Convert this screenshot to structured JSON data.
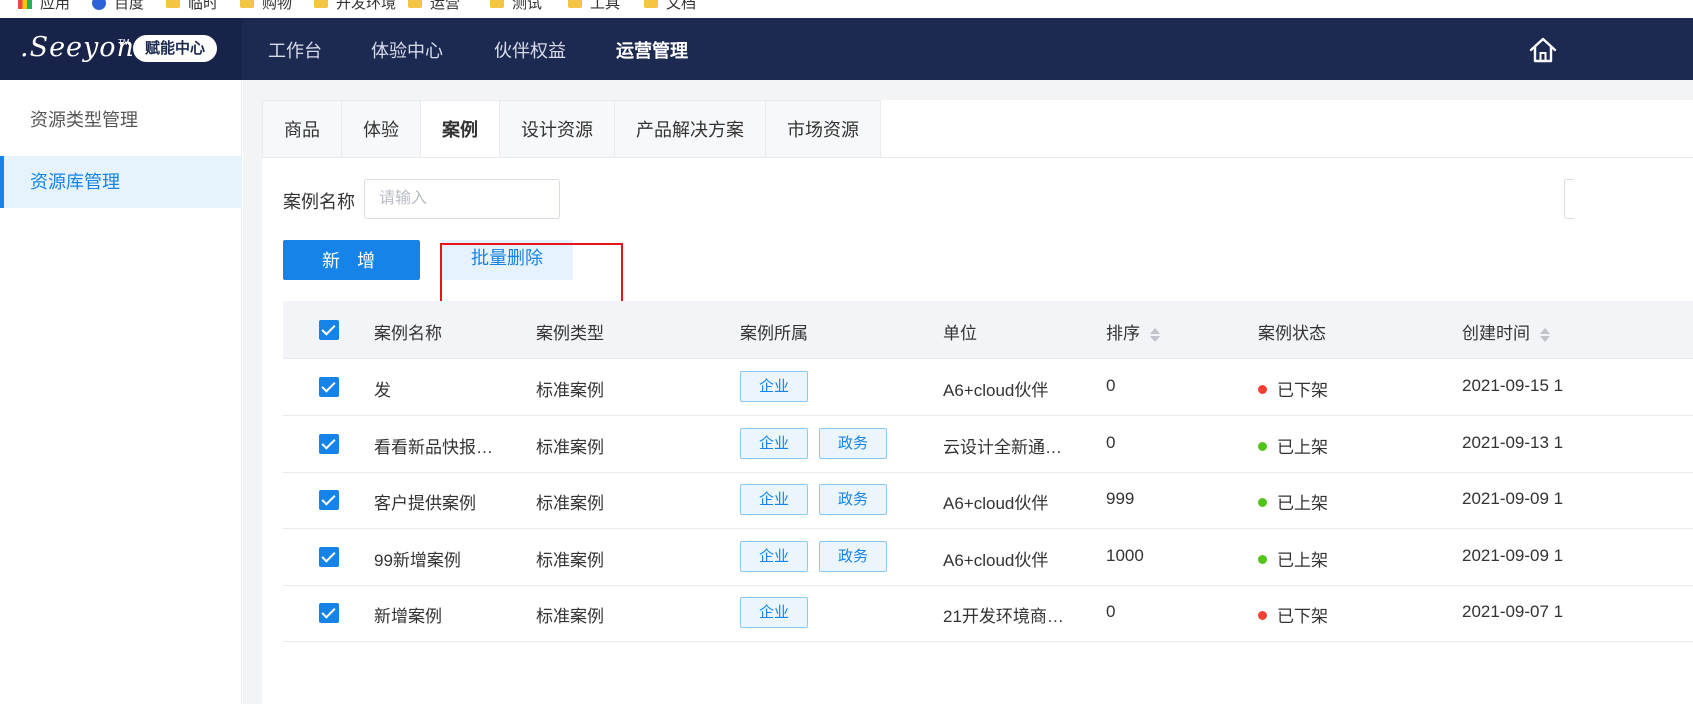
{
  "bookmarks": [
    "应用",
    "百度",
    "临时",
    "购物",
    "开发环境",
    "运营",
    "测试",
    "工具",
    "文档"
  ],
  "header": {
    "logo_text": ".Seeyon",
    "logo_tm": "TM",
    "badge": "赋能中心",
    "nav": [
      "工作台",
      "体验中心",
      "伙伴权益",
      "运营管理"
    ]
  },
  "sidebar": {
    "items": [
      {
        "label": "资源类型管理"
      },
      {
        "label": "资源库管理"
      }
    ]
  },
  "tabs": [
    "商品",
    "体验",
    "案例",
    "设计资源",
    "产品解决方案",
    "市场资源"
  ],
  "filter": {
    "label": "案例名称",
    "placeholder": "请输入"
  },
  "actions": {
    "add": "新 增",
    "batch_delete": "批量删除"
  },
  "table": {
    "headers": [
      "案例名称",
      "案例类型",
      "案例所属",
      "单位",
      "排序",
      "案例状态",
      "创建时间"
    ],
    "rows": [
      {
        "name": "发",
        "type": "标准案例",
        "tags": [
          "企业"
        ],
        "unit": "A6+cloud伙伴",
        "order": "0",
        "status": "已下架",
        "status_color": "#f04134",
        "created": "2021-09-15 1"
      },
      {
        "name": "看看新品快报…",
        "type": "标准案例",
        "tags": [
          "企业",
          "政务"
        ],
        "unit": "云设计全新通…",
        "order": "0",
        "status": "已上架",
        "status_color": "#52c41a",
        "created": "2021-09-13 1"
      },
      {
        "name": "客户提供案例",
        "type": "标准案例",
        "tags": [
          "企业",
          "政务"
        ],
        "unit": "A6+cloud伙伴",
        "order": "999",
        "status": "已上架",
        "status_color": "#52c41a",
        "created": "2021-09-09 1"
      },
      {
        "name": "99新增案例",
        "type": "标准案例",
        "tags": [
          "企业",
          "政务"
        ],
        "unit": "A6+cloud伙伴",
        "order": "1000",
        "status": "已上架",
        "status_color": "#52c41a",
        "created": "2021-09-09 1"
      },
      {
        "name": "新增案例",
        "type": "标准案例",
        "tags": [
          "企业"
        ],
        "unit": "21开发环境商…",
        "order": "0",
        "status": "已下架",
        "status_color": "#f04134",
        "created": "2021-09-07 1"
      }
    ]
  },
  "colors": {
    "nav_bg": "#1c2951",
    "primary": "#1683e8",
    "highlight": "#e8141b"
  }
}
